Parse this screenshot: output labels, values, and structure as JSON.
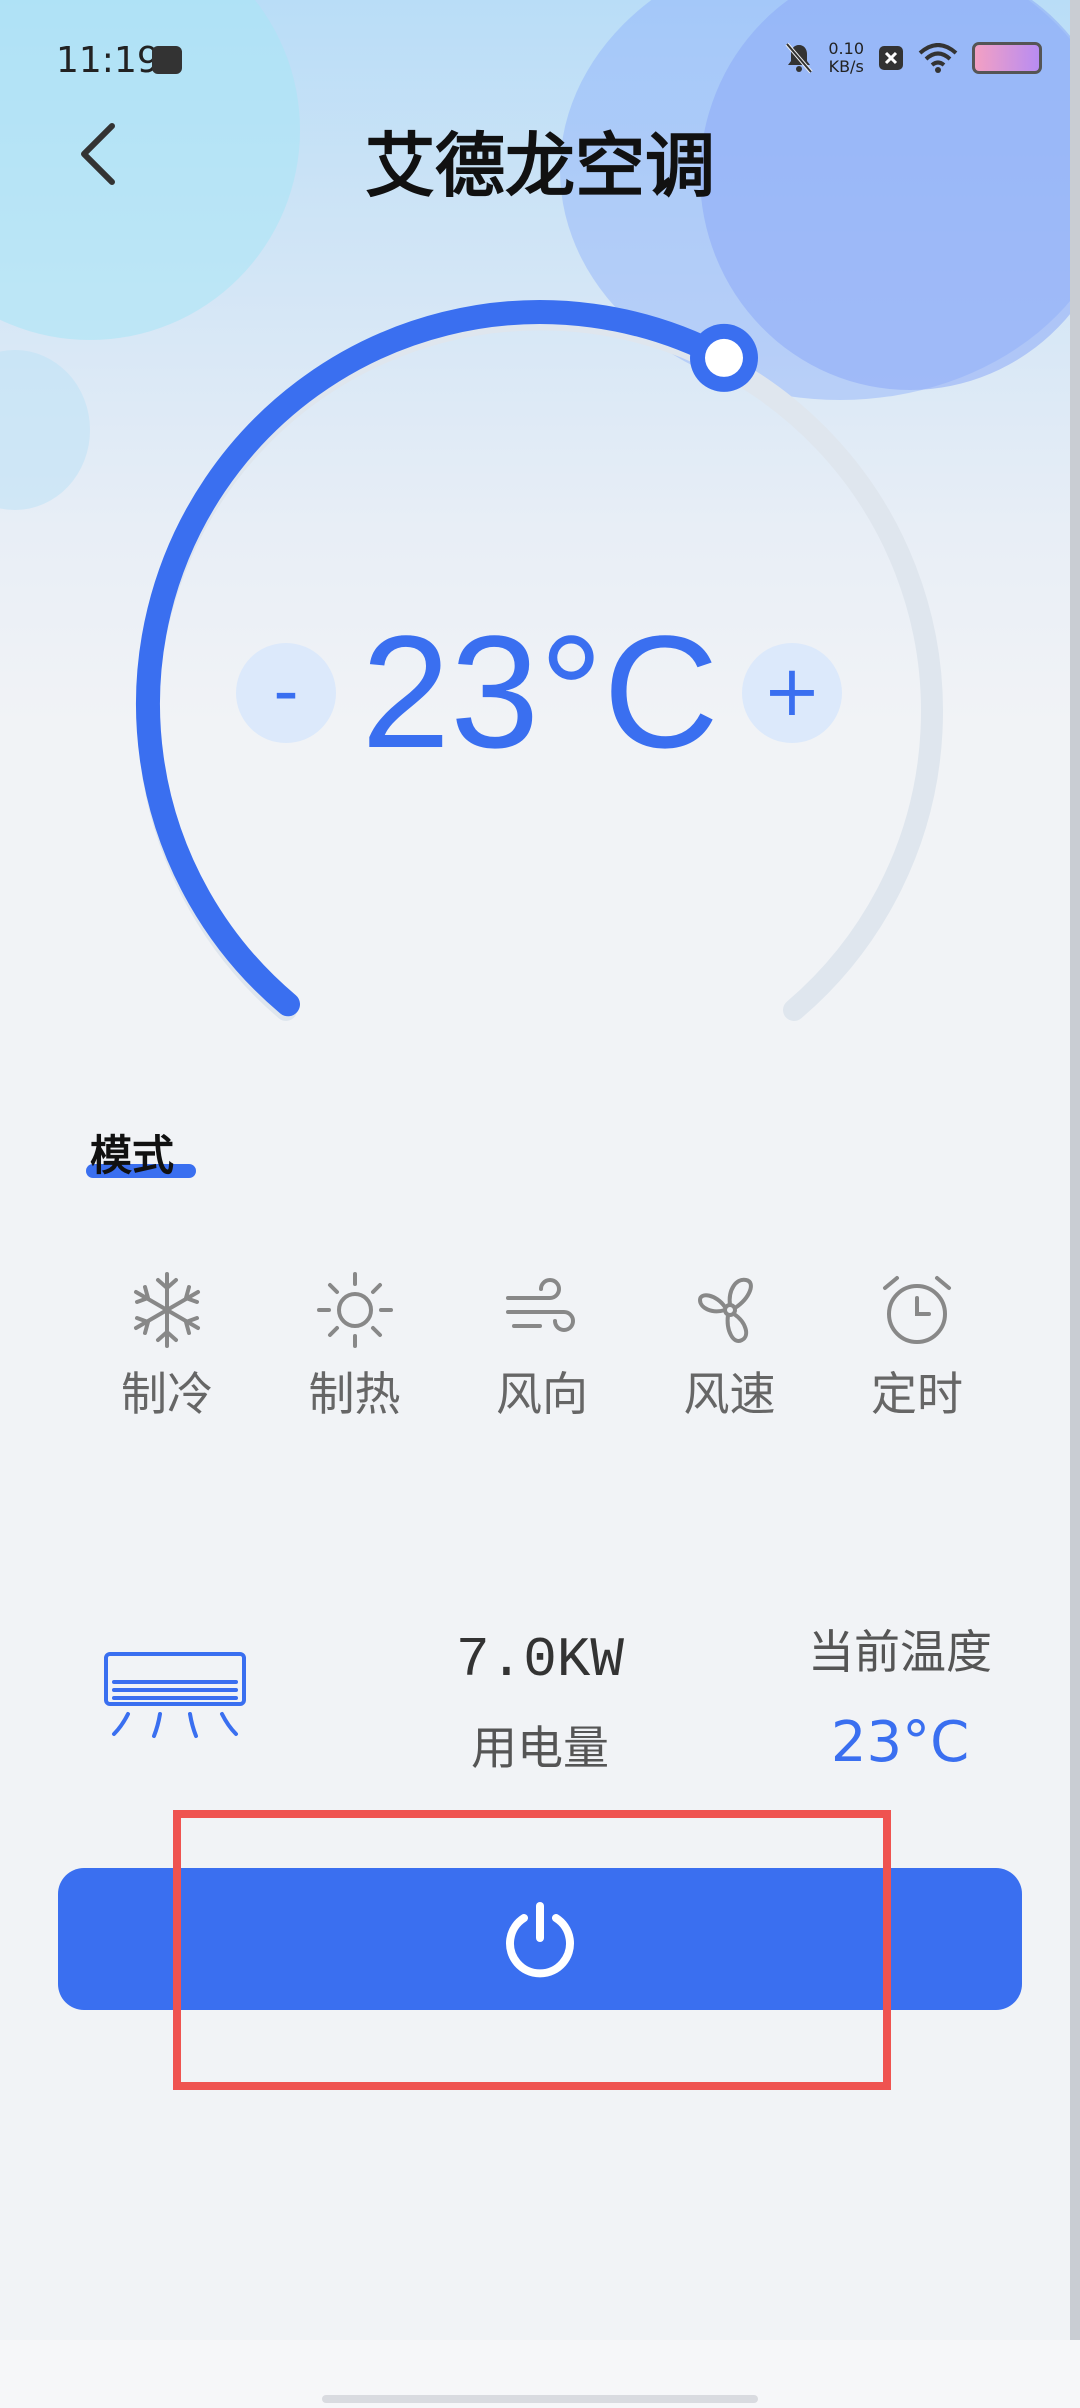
{
  "status_bar": {
    "time": "11:19",
    "net_speed_value": "0.10",
    "net_speed_unit": "KB/s"
  },
  "header": {
    "title": "艾德龙空调"
  },
  "thermostat": {
    "temperature": "23°C",
    "minus_label": "-",
    "plus_label": "+",
    "arc_level": 0.6
  },
  "mode_section": {
    "title": "模式",
    "items": [
      {
        "label": "制冷",
        "icon": "snowflake-icon"
      },
      {
        "label": "制热",
        "icon": "sun-icon"
      },
      {
        "label": "风向",
        "icon": "wind-icon"
      },
      {
        "label": "风速",
        "icon": "fan-icon"
      },
      {
        "label": "定时",
        "icon": "alarm-clock-icon"
      }
    ]
  },
  "stats": {
    "power_value": "7.0KW",
    "power_label": "用电量",
    "current_temp_label": "当前温度",
    "current_temp_value": "23°C"
  },
  "power_button": {
    "icon": "power-icon"
  },
  "colors": {
    "accent": "#3a6ff0",
    "track": "#dfe6ee",
    "highlight": "#ef5350"
  }
}
